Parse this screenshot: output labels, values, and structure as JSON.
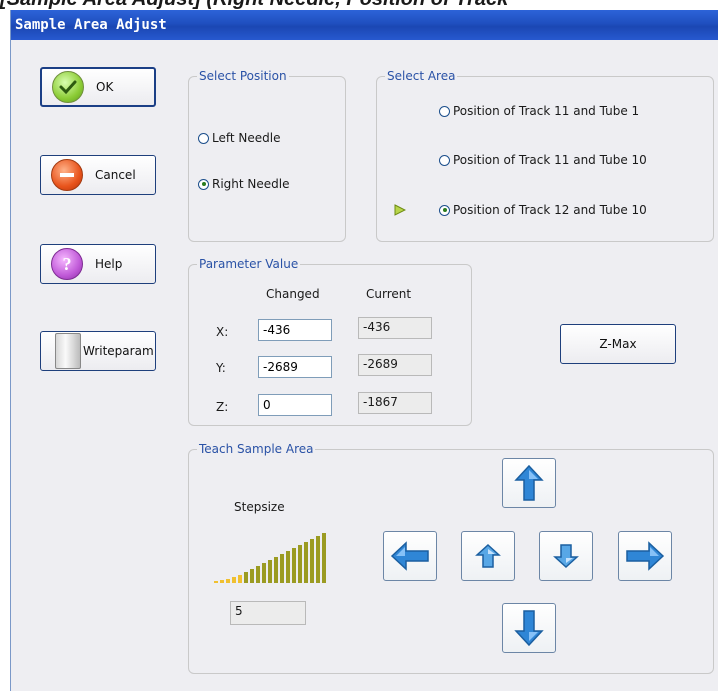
{
  "doc_clip_text": "[Sample Area Adjust] (Right Needle, Position of Track",
  "window": {
    "title": "Sample Area Adjust"
  },
  "buttons": {
    "ok": "OK",
    "cancel": "Cancel",
    "help": "Help",
    "writeparam": "Writeparam",
    "zmax": "Z-Max"
  },
  "select_position": {
    "title": "Select Position",
    "options": [
      {
        "label": "Left Needle",
        "selected": false
      },
      {
        "label": "Right Needle",
        "selected": true
      }
    ]
  },
  "select_area": {
    "title": "Select Area",
    "options": [
      {
        "label": "Position of Track 11 and Tube 1",
        "selected": false
      },
      {
        "label": "Position of Track 11 and Tube 10",
        "selected": false
      },
      {
        "label": "Position of Track 12 and Tube 10",
        "selected": true
      }
    ],
    "indicator_icon": "play-arrow-icon"
  },
  "parameter_value": {
    "title": "Parameter Value",
    "col_changed": "Changed",
    "col_current": "Current",
    "rows": [
      {
        "label": "X:",
        "changed": "-436",
        "current": "-436"
      },
      {
        "label": "Y:",
        "changed": "-2689",
        "current": "-2689"
      },
      {
        "label": "Z:",
        "changed": "0",
        "current": "-1867"
      }
    ]
  },
  "teach": {
    "title": "Teach Sample Area",
    "stepsize_label": "Stepsize",
    "stepsize_value": "5",
    "arrows": [
      "arrow-up-icon",
      "arrow-left-icon",
      "arrow-z-up-icon",
      "arrow-z-down-icon",
      "arrow-right-icon",
      "arrow-down-icon"
    ]
  },
  "colors": {
    "title_bar": "#1f4fbf",
    "group_title": "#2a52a6",
    "stepsize_active": "#9b9b22",
    "stepsize_inactive": "#f0c030",
    "arrow_blue": "#2f86d6"
  }
}
